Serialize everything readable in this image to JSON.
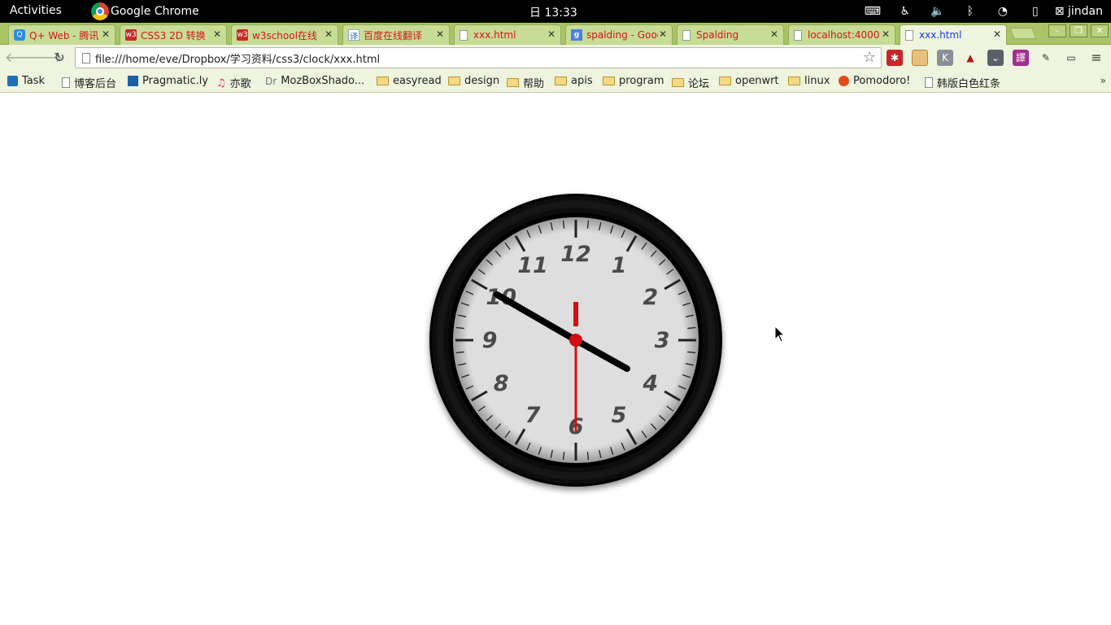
{
  "topbar": {
    "activities": "Activities",
    "app_name": "Google Chrome",
    "clock": "日 13:33",
    "user": "jindan",
    "tray_icons": [
      "keyboard-icon",
      "accessibility-icon",
      "volume-icon",
      "bluetooth-icon",
      "wifi-icon",
      "battery-icon"
    ]
  },
  "tabs": [
    {
      "title": "Q+ Web - 腾讯",
      "favicon": "qplus-icon",
      "active": false
    },
    {
      "title": "CSS3 2D 转换",
      "favicon": "w3-icon",
      "active": false
    },
    {
      "title": "w3school在线",
      "favicon": "w3-icon",
      "active": false
    },
    {
      "title": "百度在线翻译",
      "favicon": "translate-icon",
      "active": false
    },
    {
      "title": "xxx.html",
      "favicon": "page-icon",
      "active": false
    },
    {
      "title": "spalding - Goog",
      "favicon": "google-icon",
      "active": false
    },
    {
      "title": "Spalding",
      "favicon": "page-icon",
      "active": false
    },
    {
      "title": "localhost:4000/",
      "favicon": "page-icon",
      "active": false
    },
    {
      "title": "xxx.html",
      "favicon": "page-icon",
      "active": true
    }
  ],
  "omnibox": {
    "url": "file:///home/eve/Dropbox/学习资料/css3/clock/xxx.html"
  },
  "bookmarks": [
    {
      "label": "Task",
      "icon": "trello-icon"
    },
    {
      "label": "博客后台",
      "icon": "page-icon"
    },
    {
      "label": "Pragmatic.ly",
      "icon": "pragmatic-icon"
    },
    {
      "label": "亦歌",
      "icon": "music-icon"
    },
    {
      "label": "MozBoxShado...",
      "icon": "dr-icon"
    },
    {
      "label": "easyread",
      "icon": "folder-icon"
    },
    {
      "label": "design",
      "icon": "folder-icon"
    },
    {
      "label": "帮助",
      "icon": "folder-icon"
    },
    {
      "label": "apis",
      "icon": "folder-icon"
    },
    {
      "label": "program",
      "icon": "folder-icon"
    },
    {
      "label": "论坛",
      "icon": "folder-icon"
    },
    {
      "label": "openwrt",
      "icon": "folder-icon"
    },
    {
      "label": "linux",
      "icon": "folder-icon"
    },
    {
      "label": "Pomodoro!",
      "icon": "tomato-icon"
    },
    {
      "label": "韩版白色红条",
      "icon": "page-icon"
    }
  ],
  "clock": {
    "numerals": [
      "12",
      "1",
      "2",
      "3",
      "4",
      "5",
      "6",
      "7",
      "8",
      "9",
      "10",
      "11"
    ],
    "time": {
      "hours": 3.97,
      "minutes": 50,
      "seconds": 30
    },
    "colors": {
      "face": "#dedede",
      "rim": "#000000",
      "hands": "#000000",
      "second_hand": "#d01010",
      "numerals": "#4a4a4a"
    }
  }
}
